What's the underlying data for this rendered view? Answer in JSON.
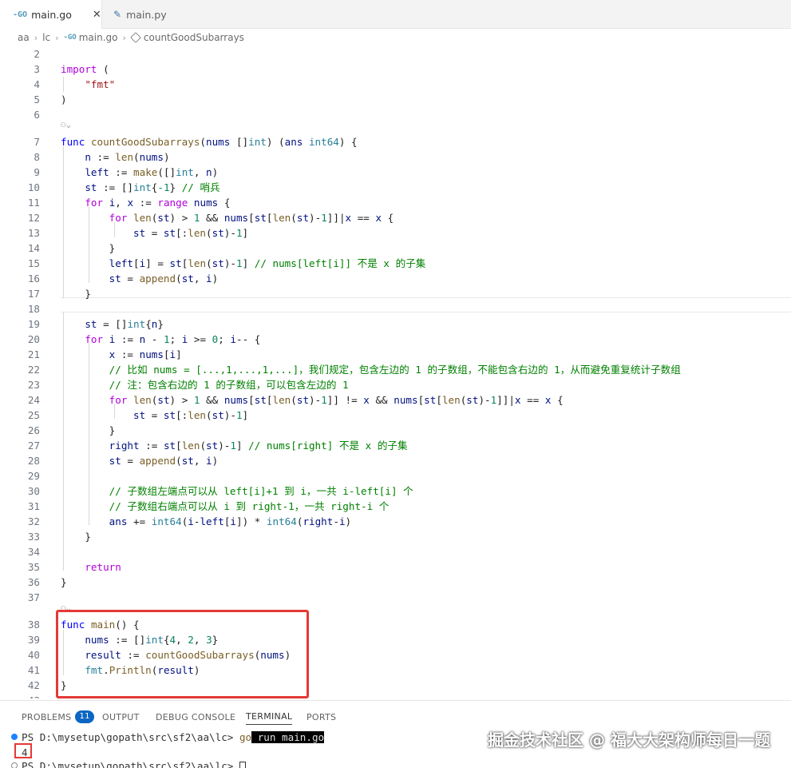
{
  "tabs": [
    {
      "label": "main.go",
      "icon": "go-file-icon",
      "active": true
    },
    {
      "label": "main.py",
      "icon": "python-file-icon",
      "active": false
    }
  ],
  "breadcrumb": [
    "aa",
    "lc",
    "main.go",
    "countGoodSubarrays"
  ],
  "codelens": "⚇⌄",
  "code_lines": [
    {
      "n": "2",
      "html": ""
    },
    {
      "n": "3",
      "html": "<span class='kw'>import</span> ("
    },
    {
      "n": "4",
      "html": "    <span class='s'>\"fmt\"</span>"
    },
    {
      "n": "5",
      "html": ")"
    },
    {
      "n": "6",
      "html": ""
    },
    {
      "n": "7",
      "html": "<span class='k'>func</span> <span class='f'>countGoodSubarrays</span>(<span class='v'>nums</span> []<span class='t'>int</span>) (<span class='v'>ans</span> <span class='t'>int64</span>) {"
    },
    {
      "n": "8",
      "html": "    <span class='v'>n</span> := <span class='f'>len</span>(<span class='v'>nums</span>)"
    },
    {
      "n": "9",
      "html": "    <span class='v'>left</span> := <span class='f'>make</span>([]<span class='t'>int</span>, <span class='v'>n</span>)"
    },
    {
      "n": "10",
      "html": "    <span class='v'>st</span> := []<span class='t'>int</span>{<span class='n'>-1</span>} <span class='c'>// 哨兵</span>"
    },
    {
      "n": "11",
      "html": "    <span class='kw'>for</span> <span class='v'>i</span>, <span class='v'>x</span> := <span class='kw'>range</span> <span class='v'>nums</span> {"
    },
    {
      "n": "12",
      "html": "        <span class='kw'>for</span> <span class='f'>len</span>(<span class='v'>st</span>) > <span class='n'>1</span> && <span class='v'>nums</span>[<span class='v'>st</span>[<span class='f'>len</span>(<span class='v'>st</span>)-<span class='n'>1</span>]]|<span class='v'>x</span> == <span class='v'>x</span> {"
    },
    {
      "n": "13",
      "html": "            <span class='v'>st</span> = <span class='v'>st</span>[:<span class='f'>len</span>(<span class='v'>st</span>)-<span class='n'>1</span>]"
    },
    {
      "n": "14",
      "html": "        }"
    },
    {
      "n": "15",
      "html": "        <span class='v'>left</span>[<span class='v'>i</span>] = <span class='v'>st</span>[<span class='f'>len</span>(<span class='v'>st</span>)-<span class='n'>1</span>] <span class='c'>// nums[left[i]] 不是 x 的子集</span>"
    },
    {
      "n": "16",
      "html": "        <span class='v'>st</span> = <span class='f'>append</span>(<span class='v'>st</span>, <span class='v'>i</span>)"
    },
    {
      "n": "17",
      "html": "    }"
    },
    {
      "n": "18",
      "html": ""
    },
    {
      "n": "19",
      "html": "    <span class='v'>st</span> = []<span class='t'>int</span>{<span class='v'>n</span>}"
    },
    {
      "n": "20",
      "html": "    <span class='kw'>for</span> <span class='v'>i</span> := <span class='v'>n</span> - <span class='n'>1</span>; <span class='v'>i</span> >= <span class='n'>0</span>; <span class='v'>i</span>-- {"
    },
    {
      "n": "21",
      "html": "        <span class='v'>x</span> := <span class='v'>nums</span>[<span class='v'>i</span>]"
    },
    {
      "n": "22",
      "html": "        <span class='c'>// 比如 nums = [...,1,...,1,...]，我们规定，包含左边的 1 的子数组，不能包含右边的 1，从而避免重复统计子数组</span>"
    },
    {
      "n": "23",
      "html": "        <span class='c'>// 注：包含右边的 1 的子数组，可以包含左边的 1</span>"
    },
    {
      "n": "24",
      "html": "        <span class='kw'>for</span> <span class='f'>len</span>(<span class='v'>st</span>) > <span class='n'>1</span> && <span class='v'>nums</span>[<span class='v'>st</span>[<span class='f'>len</span>(<span class='v'>st</span>)-<span class='n'>1</span>]] != <span class='v'>x</span> && <span class='v'>nums</span>[<span class='v'>st</span>[<span class='f'>len</span>(<span class='v'>st</span>)-<span class='n'>1</span>]]|<span class='v'>x</span> == <span class='v'>x</span> {"
    },
    {
      "n": "25",
      "html": "            <span class='v'>st</span> = <span class='v'>st</span>[:<span class='f'>len</span>(<span class='v'>st</span>)-<span class='n'>1</span>]"
    },
    {
      "n": "26",
      "html": "        }"
    },
    {
      "n": "27",
      "html": "        <span class='v'>right</span> := <span class='v'>st</span>[<span class='f'>len</span>(<span class='v'>st</span>)-<span class='n'>1</span>] <span class='c'>// nums[right] 不是 x 的子集</span>"
    },
    {
      "n": "28",
      "html": "        <span class='v'>st</span> = <span class='f'>append</span>(<span class='v'>st</span>, <span class='v'>i</span>)"
    },
    {
      "n": "29",
      "html": ""
    },
    {
      "n": "30",
      "html": "        <span class='c'>// 子数组左端点可以从 left[i]+1 到 i，一共 i-left[i] 个</span>"
    },
    {
      "n": "31",
      "html": "        <span class='c'>// 子数组右端点可以从 i 到 right-1，一共 right-i 个</span>"
    },
    {
      "n": "32",
      "html": "        <span class='v'>ans</span> += <span class='t'>int64</span>(<span class='v'>i</span>-<span class='v'>left</span>[<span class='v'>i</span>]) * <span class='t'>int64</span>(<span class='v'>right</span>-<span class='v'>i</span>)"
    },
    {
      "n": "33",
      "html": "    }"
    },
    {
      "n": "34",
      "html": ""
    },
    {
      "n": "35",
      "html": "    <span class='kw'>return</span>"
    },
    {
      "n": "36",
      "html": "}"
    },
    {
      "n": "37",
      "html": ""
    },
    {
      "n": "38",
      "html": "<span class='k'>func</span> <span class='f'>main</span>() {"
    },
    {
      "n": "39",
      "html": "    <span class='v'>nums</span> := []<span class='t'>int</span>{<span class='n'>4</span>, <span class='n'>2</span>, <span class='n'>3</span>}"
    },
    {
      "n": "40",
      "html": "    <span class='v'>result</span> := <span class='f'>countGoodSubarrays</span>(<span class='v'>nums</span>)"
    },
    {
      "n": "41",
      "html": "    <span class='t'>fmt</span>.<span class='f'>Println</span>(<span class='v'>result</span>)"
    },
    {
      "n": "42",
      "html": "}"
    },
    {
      "n": "43",
      "html": ""
    }
  ],
  "panel": {
    "tabs": [
      {
        "label": "PROBLEMS",
        "badge": "11"
      },
      {
        "label": "OUTPUT"
      },
      {
        "label": "DEBUG CONSOLE"
      },
      {
        "label": "TERMINAL",
        "active": true
      },
      {
        "label": "PORTS"
      }
    ],
    "terminal": {
      "prompt1": "PS D:\\mysetup\\gopath\\src\\sf2\\aa\\lc> ",
      "cmd_prefix": "go",
      "cmd_rest": " run main.go",
      "output": "4",
      "prompt2": "PS D:\\mysetup\\gopath\\src\\sf2\\aa\\lc> "
    }
  },
  "watermark": "掘金技术社区 @ 福大大架构师每日一题",
  "colors": {
    "keyword": "#0000ff",
    "control": "#af00db",
    "function": "#795e26",
    "string": "#a31515",
    "number": "#098658",
    "comment": "#008000",
    "type": "#267f99",
    "highlight": "#e53935"
  }
}
